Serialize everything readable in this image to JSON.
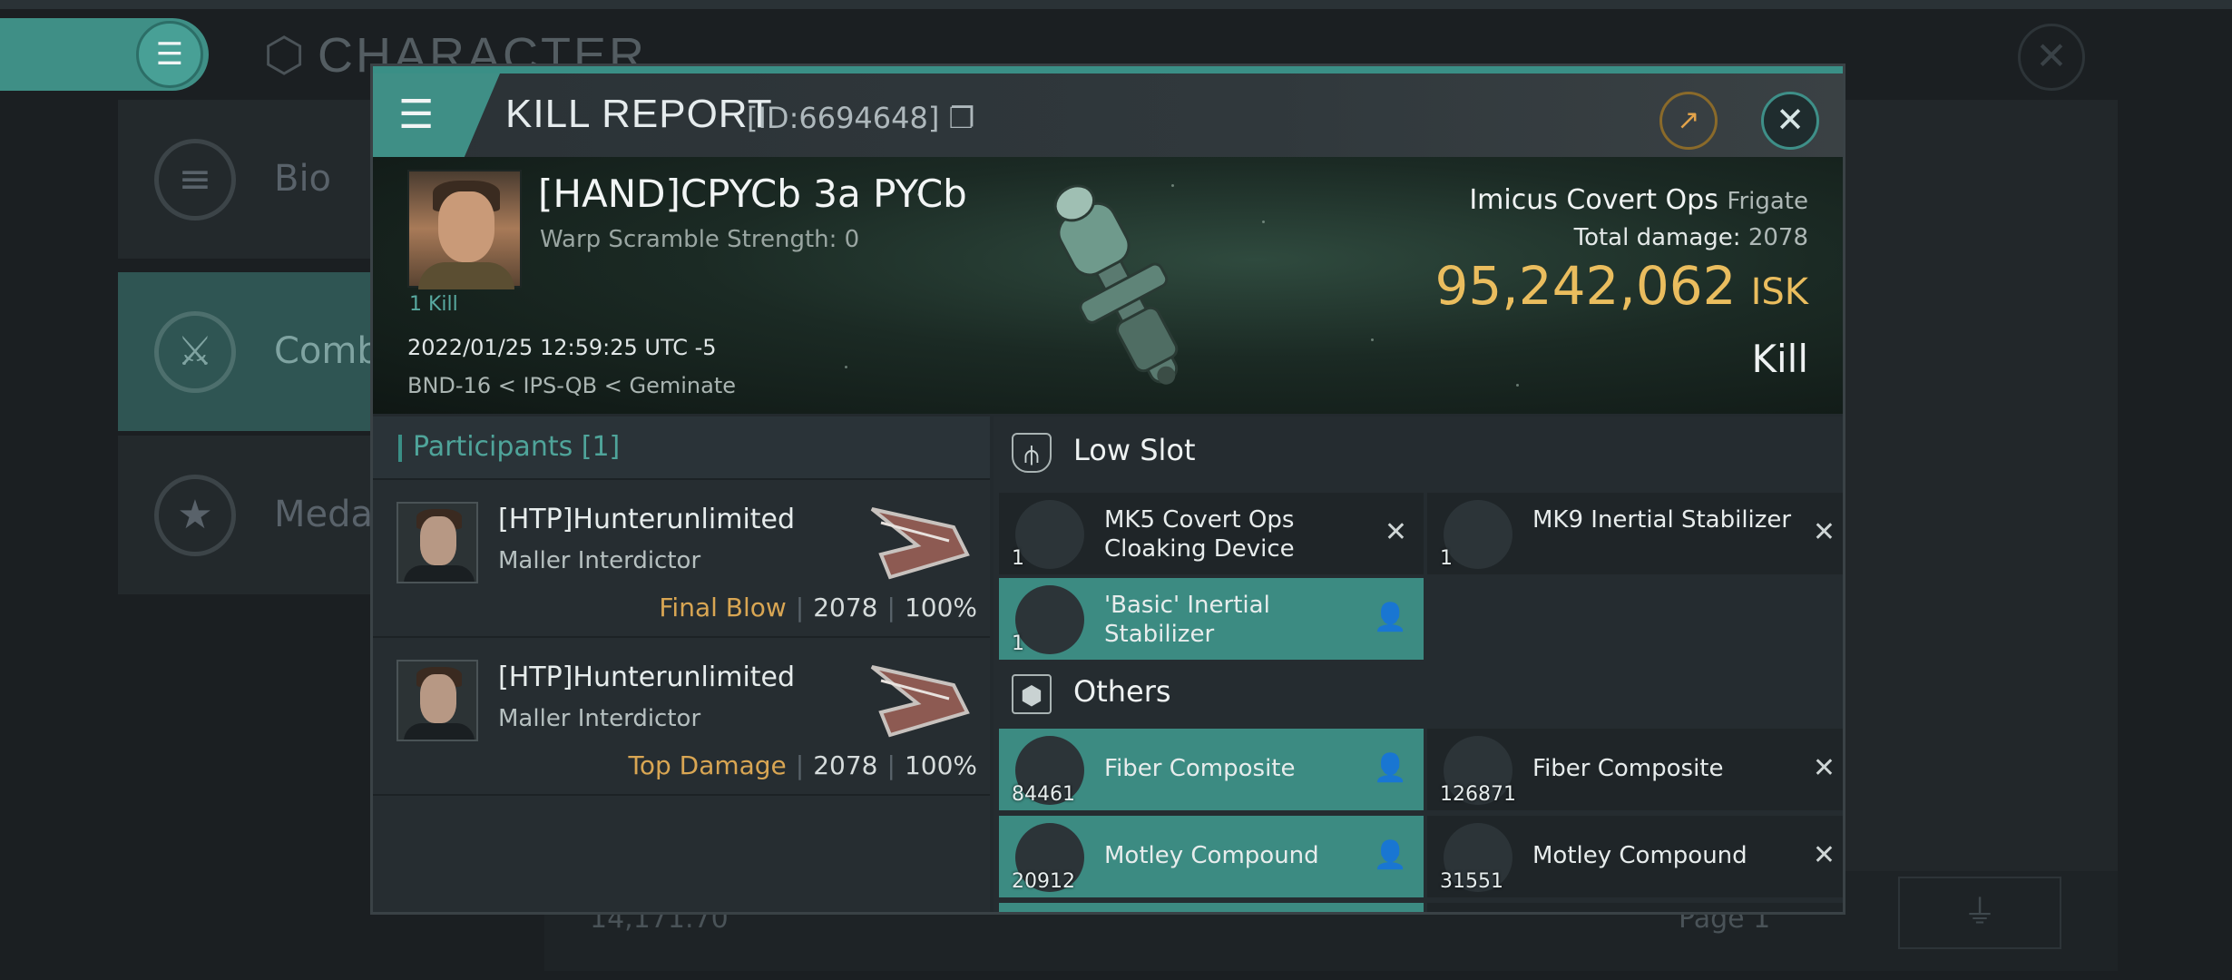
{
  "background": {
    "title": "CHARACTER",
    "sidebar": [
      {
        "label": "Bio"
      },
      {
        "label": "Comb"
      },
      {
        "label": "Medal"
      }
    ],
    "wallet_value": "14,171.70",
    "page_label": "Page 1"
  },
  "modal": {
    "title": "KILL REPORT",
    "id_label": "[ID:6694648]",
    "victim": {
      "name": "[HAND]CPYCb 3a PYCb",
      "warp_scramble": "Warp Scramble Strength: 0",
      "kill_tag": "1 Kill",
      "datetime": "2022/01/25 12:59:25 UTC -5",
      "location": "BND-16 < IPS-QB < Geminate"
    },
    "ship": {
      "name": "Imicus Covert Ops",
      "class": "Frigate",
      "total_damage_label": "Total damage:",
      "total_damage": "2078",
      "isk_value": "95,242,062",
      "isk_unit": "ISK",
      "result": "Kill"
    },
    "participants": {
      "header": "Participants [1]",
      "rows": [
        {
          "name": "[HTP]Hunterunlimited",
          "ship": "Maller Interdictor",
          "role": "Final Blow",
          "damage": "2078",
          "percent": "100%"
        },
        {
          "name": "[HTP]Hunterunlimited",
          "ship": "Maller Interdictor",
          "role": "Top Damage",
          "damage": "2078",
          "percent": "100%"
        }
      ]
    },
    "sections": {
      "low_slot": "Low Slot",
      "others": "Others"
    },
    "low_slot_items": [
      {
        "name": "MK5 Covert Ops Cloaking Device",
        "qty": "1",
        "status": "destroyed"
      },
      {
        "name": "MK9 Inertial Stabilizer",
        "qty": "1",
        "status": "destroyed"
      },
      {
        "name": "'Basic' Inertial Stabilizer",
        "qty": "1",
        "status": "dropped"
      }
    ],
    "other_items": [
      {
        "name": "Fiber Composite",
        "qty": "84461",
        "status": "dropped"
      },
      {
        "name": "Fiber Composite",
        "qty": "126871",
        "status": "destroyed"
      },
      {
        "name": "Motley Compound",
        "qty": "20912",
        "status": "dropped"
      },
      {
        "name": "Motley Compound",
        "qty": "31551",
        "status": "destroyed"
      }
    ]
  },
  "colors": {
    "accent": "#3f8f86",
    "isk": "#eabd5e",
    "role": "#d9a653"
  }
}
